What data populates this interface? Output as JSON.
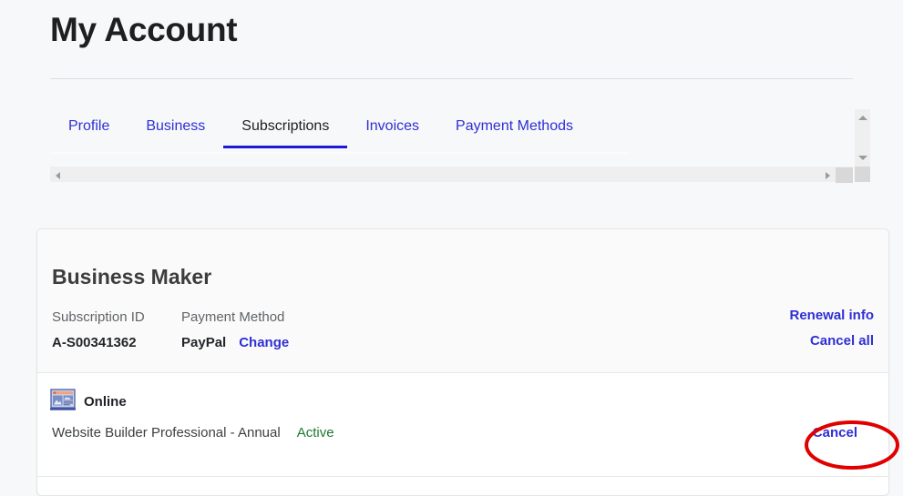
{
  "page": {
    "title": "My Account"
  },
  "tabs": {
    "items": [
      {
        "label": "Profile",
        "active": false
      },
      {
        "label": "Business",
        "active": false
      },
      {
        "label": "Subscriptions",
        "active": true
      },
      {
        "label": "Invoices",
        "active": false
      },
      {
        "label": "Payment Methods",
        "active": false
      }
    ],
    "active_index": 2
  },
  "scrollbars": {
    "horizontal": {
      "left_arrow_icon": "triangle-left-icon",
      "right_arrow_icon": "triangle-right-icon"
    },
    "vertical": {
      "up_arrow_icon": "triangle-up-icon",
      "down_arrow_icon": "triangle-down-icon"
    }
  },
  "subscription_card": {
    "plan_name": "Business Maker",
    "meta": {
      "subscription_id_label": "Subscription ID",
      "subscription_id_value": "A-S00341362",
      "payment_method_label": "Payment Method",
      "payment_method_value": "PayPal",
      "change_link": "Change"
    },
    "header_actions": {
      "renewal_info": "Renewal info",
      "cancel_all": "Cancel all"
    },
    "product_group": {
      "icon": "website-page-icon",
      "label": "Online",
      "product_name": "Website Builder Professional - Annual",
      "status": "Active",
      "status_color": "#1e7a30",
      "cancel_link": "Cancel"
    }
  },
  "annotation": {
    "shape": "ellipse",
    "color": "#e00000",
    "target": "Cancel"
  },
  "colors": {
    "page_background": "#f7f8fa",
    "link_blue": "#2f2fd4",
    "active_tab_underline": "#1a1ad6",
    "heading_dark": "#1d1f21",
    "status_green": "#1e7a30",
    "annotation_red": "#e00000"
  }
}
